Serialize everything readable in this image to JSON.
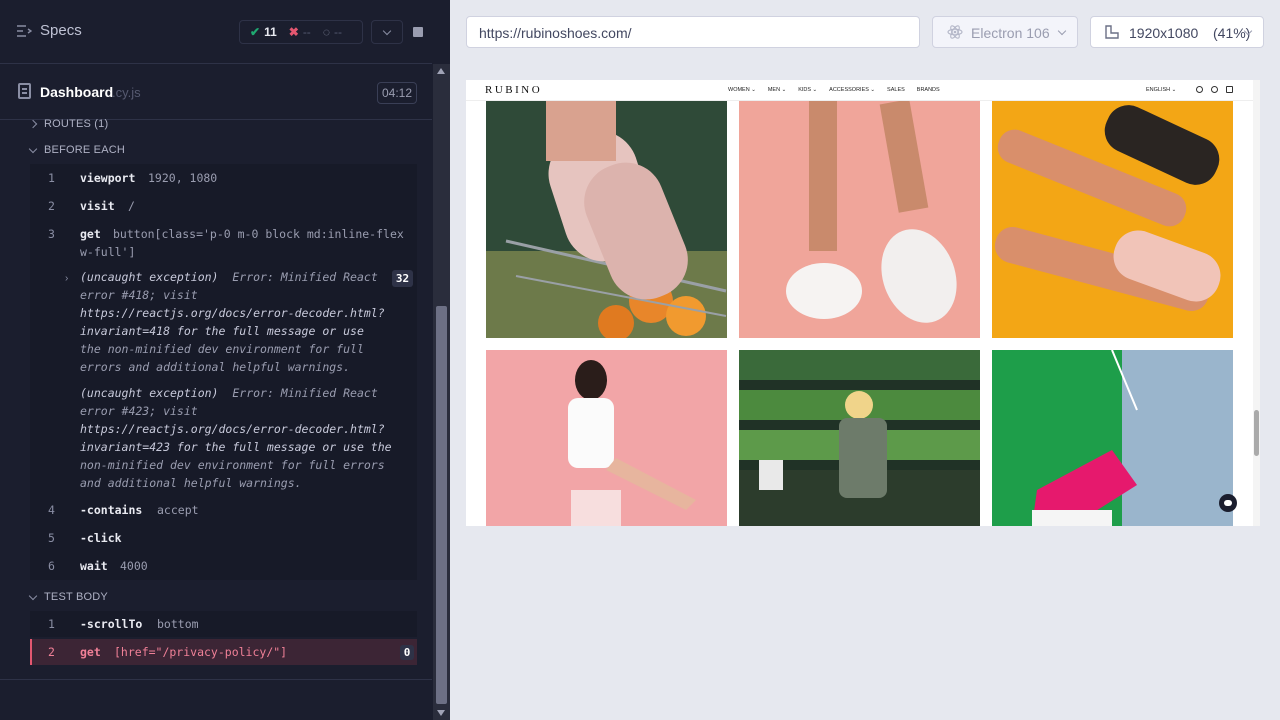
{
  "reporter": {
    "specs_label": "Specs",
    "stats": {
      "passed": "11",
      "failed": "--",
      "pending": "--"
    },
    "spec": {
      "name": "Dashboard",
      "ext": ".cy.js",
      "duration": "04:12"
    },
    "routes_label": "ROUTES (1)",
    "before_each_label": "BEFORE EACH",
    "test_body_label": "TEST BODY",
    "before_each": [
      {
        "num": "1",
        "name": "viewport",
        "msg": "1920, 1080"
      },
      {
        "num": "2",
        "name": "visit",
        "msg": "/"
      },
      {
        "num": "3",
        "name": "get",
        "msg": "button[class='p-0 m-0 block md:inline-flex",
        "msg2": "w-full']"
      },
      {
        "num": "4",
        "name": "-contains",
        "msg": "accept"
      },
      {
        "num": "5",
        "name": "-click",
        "msg": ""
      },
      {
        "num": "6",
        "name": "wait",
        "msg": "4000"
      }
    ],
    "exception_count": "32",
    "exceptions": [
      {
        "label": "(uncaught exception)",
        "lines": [
          "Error: Minified React",
          "error #418; visit",
          "https://reactjs.org/docs/error-decoder.html?",
          "invariant=418 for the full message or use",
          "the non-minified dev environment for full",
          "errors and additional helpful warnings."
        ]
      },
      {
        "label": "(uncaught exception)",
        "lines": [
          "Error: Minified React",
          "error #423; visit",
          "https://reactjs.org/docs/error-decoder.html?",
          "invariant=423 for the full message or use the",
          "non-minified dev environment for full errors",
          "and additional helpful warnings."
        ]
      }
    ],
    "test_body": [
      {
        "num": "1",
        "name": "-scrollTo",
        "msg": "bottom"
      },
      {
        "num": "2",
        "name": "get",
        "msg": "[href=\"/privacy-policy/\"]",
        "badge": "0"
      }
    ]
  },
  "browser": {
    "url": "https://rubinoshoes.com/",
    "engine": "Electron 106",
    "viewport": "1920x1080",
    "zoom": "(41%)"
  },
  "site": {
    "logo": "RUBINO",
    "menu": [
      "WOMEN ⌄",
      "MEN ⌄",
      "KIDS ⌄",
      "ACCESSORIES ⌄",
      "SALES",
      "BRANDS"
    ],
    "lang": "ENGLISH ⌄"
  },
  "colors": {
    "panel_bg": "#1b1e2e",
    "pass": "#1fa971",
    "fail": "#e45770",
    "browser_bg": "#e6e8ef"
  }
}
